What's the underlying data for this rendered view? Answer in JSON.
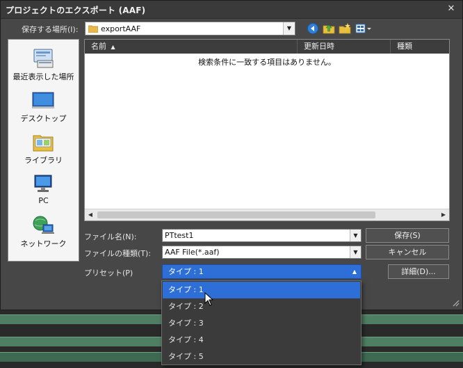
{
  "dialog": {
    "title": "プロジェクトのエクスポート (AAF)",
    "close_glyph": "✕"
  },
  "lookin": {
    "label": "保存する場所(I):",
    "value": "exportAAF"
  },
  "toolbar_icons": [
    "back-icon",
    "up-folder-icon",
    "new-folder-icon",
    "view-menu-icon"
  ],
  "places": [
    {
      "label": "最近表示した場所",
      "icon": "recent-places-icon"
    },
    {
      "label": "デスクトップ",
      "icon": "desktop-icon"
    },
    {
      "label": "ライブラリ",
      "icon": "library-icon"
    },
    {
      "label": "PC",
      "icon": "pc-icon"
    },
    {
      "label": "ネットワーク",
      "icon": "network-icon"
    }
  ],
  "filelist": {
    "columns": [
      "名前",
      "更新日時",
      "種類"
    ],
    "sort_glyph": "▲",
    "empty_message": "検索条件に一致する項目はありません。"
  },
  "form": {
    "filename_label": "ファイル名(N):",
    "filename_value": "PTtest1",
    "filetype_label": "ファイルの種類(T):",
    "filetype_value": "AAF File(*.aaf)",
    "preset_label": "プリセット(P)",
    "preset_value": "タイプ : 1"
  },
  "buttons": {
    "save": "保存(S)",
    "cancel": "キャンセル",
    "details": "詳細(D)..."
  },
  "preset_options": [
    "タイプ : 1",
    "タイプ : 2",
    "タイプ : 3",
    "タイプ : 4",
    "タイプ : 5"
  ],
  "colors": {
    "accent": "#2d6fd6",
    "dialog_bg": "#474747",
    "track_green": "#4f7f63"
  }
}
